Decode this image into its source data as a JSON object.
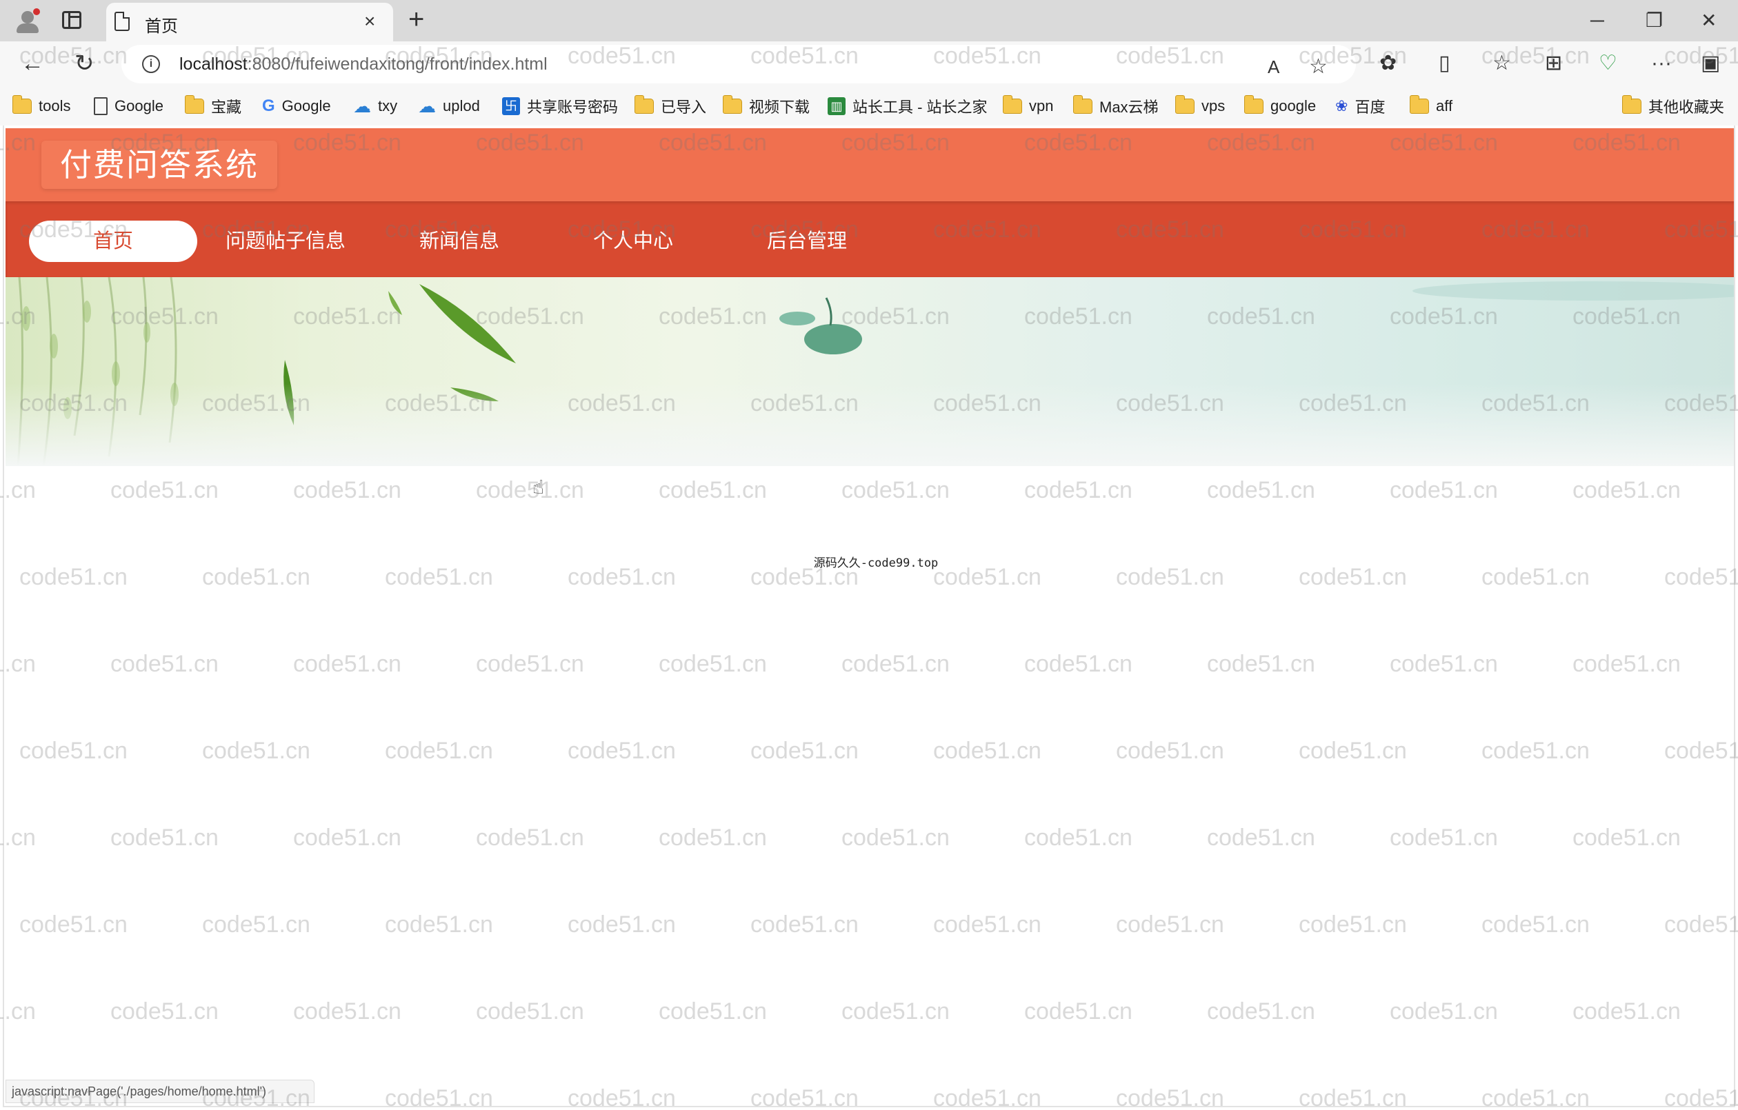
{
  "browser": {
    "tab_title": "首页",
    "tab_close": "×",
    "new_tab": "+",
    "url_host": "localhost",
    "url_rest": ":8080/fufeiwendaxitong/front/index.html",
    "window_controls": {
      "minimize": "─",
      "restore": "❐",
      "close": "✕"
    },
    "nav": {
      "back": "←",
      "reload": "↻"
    },
    "toolbar_icons": {
      "read_aloud": "A",
      "favorite": "☆",
      "extensions": "✿",
      "split": "▯",
      "favorites": "☆",
      "collections": "⊞",
      "health": "♡",
      "more": "···",
      "sidebar": "▣"
    }
  },
  "bookmarks": [
    {
      "label": "tools",
      "icon": "folder-icon"
    },
    {
      "label": "Google",
      "icon": "page-icon"
    },
    {
      "label": "宝藏",
      "icon": "folder-icon"
    },
    {
      "label": "Google",
      "icon": "google-icon"
    },
    {
      "label": "txy",
      "icon": "cloud-icon"
    },
    {
      "label": "uplod",
      "icon": "cloud-icon"
    },
    {
      "label": "共享账号密码",
      "icon": "share-icon"
    },
    {
      "label": "已导入",
      "icon": "folder-icon"
    },
    {
      "label": "视频下载",
      "icon": "folder-icon"
    },
    {
      "label": "站长工具 - 站长之家",
      "icon": "chart-icon"
    },
    {
      "label": "vpn",
      "icon": "folder-icon"
    },
    {
      "label": "Max云梯",
      "icon": "folder-icon"
    },
    {
      "label": "vps",
      "icon": "folder-icon"
    },
    {
      "label": "google",
      "icon": "folder-icon"
    },
    {
      "label": "百度",
      "icon": "baidu-icon"
    },
    {
      "label": "aff",
      "icon": "folder-icon"
    }
  ],
  "other_bookmarks": "其他收藏夹",
  "site": {
    "title": "付费问答系统",
    "nav": [
      "首页",
      "问题帖子信息",
      "新闻信息",
      "个人中心",
      "后台管理"
    ],
    "active_nav": "首页",
    "center_text": "源码久久-code99.top"
  },
  "status_bar": "javascript:navPage('./pages/home/home.html')",
  "watermark_text": "code51.cn",
  "colors": {
    "header": "#f0704f",
    "navbar": "#d84a30",
    "active_nav_bg": "#ffffff"
  }
}
